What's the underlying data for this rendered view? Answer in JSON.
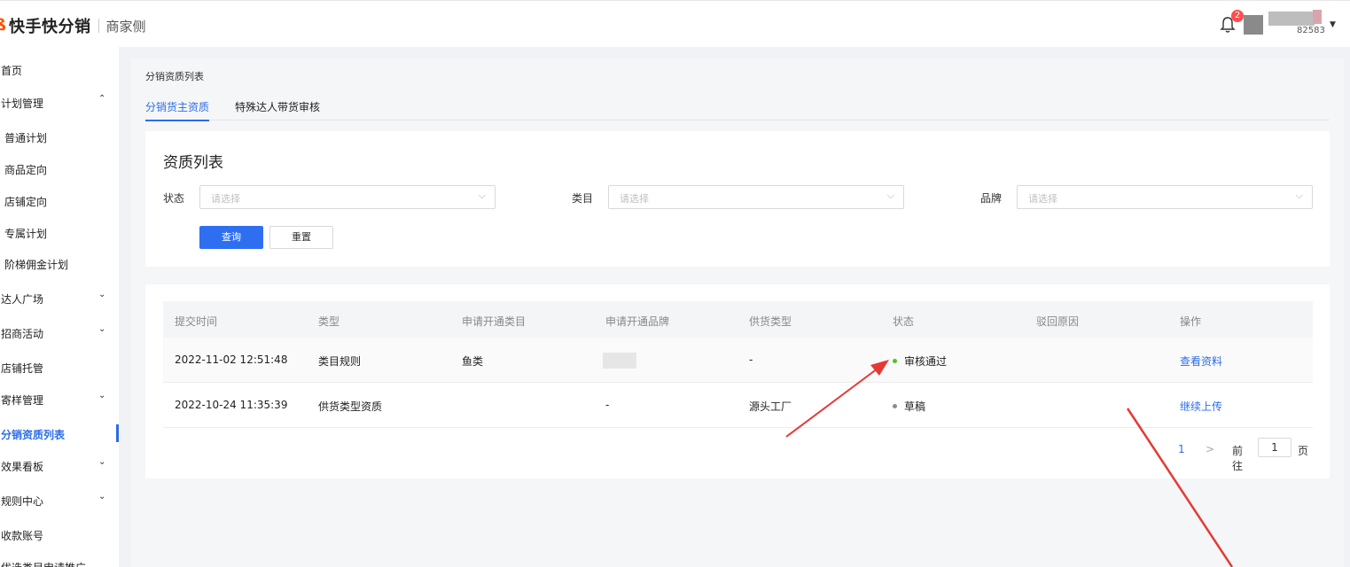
{
  "header": {
    "logo_mark": "ß",
    "brand": "快手快分销",
    "sub": "商家侧",
    "notification_count": "2",
    "user_id_partial": "82583"
  },
  "sidebar": {
    "items": [
      {
        "label": "首页",
        "chevron": ""
      },
      {
        "label": "计划管理",
        "chevron": "^"
      },
      {
        "label": "普通计划",
        "chevron": ""
      },
      {
        "label": "商品定向",
        "chevron": ""
      },
      {
        "label": "店铺定向",
        "chevron": ""
      },
      {
        "label": "专属计划",
        "chevron": ""
      },
      {
        "label": "阶梯佣金计划",
        "chevron": ""
      },
      {
        "label": "达人广场",
        "chevron": "v"
      },
      {
        "label": "招商活动",
        "chevron": "v"
      },
      {
        "label": "店铺托管",
        "chevron": ""
      },
      {
        "label": "寄样管理",
        "chevron": "v"
      },
      {
        "label": "分销资质列表",
        "chevron": ""
      },
      {
        "label": "效果看板",
        "chevron": "v"
      },
      {
        "label": "规则中心",
        "chevron": "v"
      },
      {
        "label": "收款账号",
        "chevron": ""
      },
      {
        "label": "优选类目申请推广",
        "chevron": ""
      }
    ]
  },
  "main": {
    "breadcrumb": "分销资质列表",
    "tabs": [
      "分销货主资质",
      "特殊达人带货审核"
    ],
    "filter": {
      "title": "资质列表",
      "status_label": "状态",
      "category_label": "类目",
      "brand_label": "品牌",
      "placeholder": "请选择",
      "query_button": "查询",
      "reset_button": "重置"
    },
    "table": {
      "columns": [
        "提交时间",
        "类型",
        "申请开通类目",
        "申请开通品牌",
        "供货类型",
        "状态",
        "驳回原因",
        "操作"
      ],
      "rows": [
        {
          "time": "2022-11-02 12:51:48",
          "type": "类目规则",
          "category": "鱼类",
          "brand": "",
          "supply": "-",
          "status": "审核通过",
          "status_color": "#52c41a",
          "reason": "",
          "action": "查看资料"
        },
        {
          "time": "2022-10-24 11:35:39",
          "type": "供货类型资质",
          "category": "",
          "brand": "-",
          "supply": "源头工厂",
          "status": "草稿",
          "status_color": "#8c8c8c",
          "reason": "",
          "action": "继续上传"
        }
      ]
    },
    "pagination": {
      "current": "1",
      "next": ">",
      "goto_label": "前往",
      "goto_value": "1",
      "unit": "页"
    }
  },
  "colors": {
    "accent": "#2b6de8",
    "annotation_arrow": "#e53935"
  }
}
